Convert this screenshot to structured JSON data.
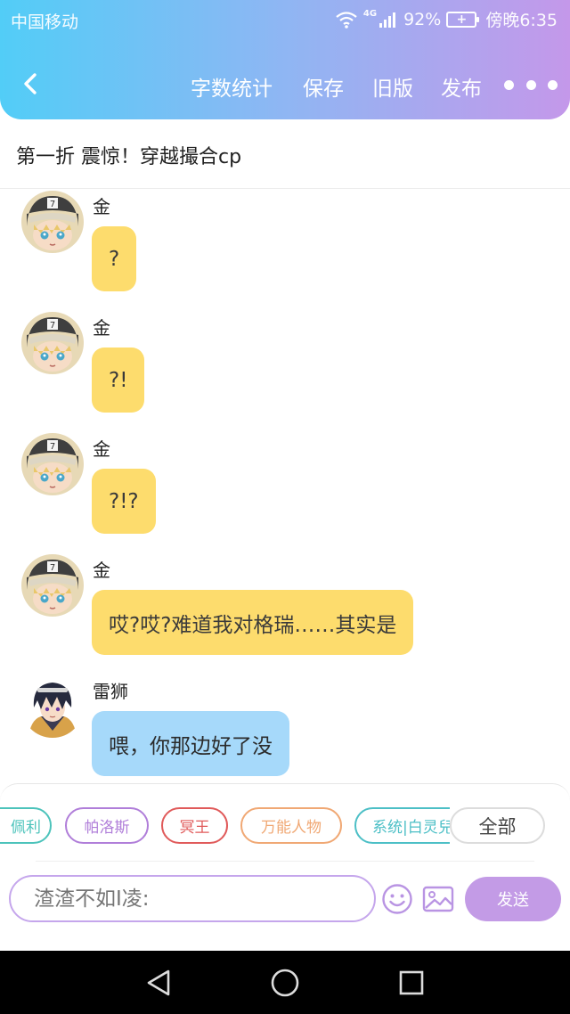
{
  "status_bar": {
    "carrier": "中国移动",
    "network": "4G",
    "battery": "92%",
    "time": "傍晚6:35"
  },
  "toolbar": {
    "word_count": "字数统计",
    "save": "保存",
    "old_version": "旧版",
    "publish": "发布"
  },
  "chapter": {
    "title": "第一折 震惊！穿越撮合cp"
  },
  "messages": [
    {
      "sender": "金",
      "text": "?",
      "style": "yellow"
    },
    {
      "sender": "金",
      "text": "?!",
      "style": "yellow"
    },
    {
      "sender": "金",
      "text": "?!?",
      "style": "yellow"
    },
    {
      "sender": "金",
      "text": "哎?哎?难道我对格瑞……其实是",
      "style": "yellow"
    },
    {
      "sender": "雷狮",
      "text": "喂，你那边好了没",
      "style": "blue"
    }
  ],
  "characters": [
    {
      "name": "佩利",
      "color": "#4cc3bb"
    },
    {
      "name": "帕洛斯",
      "color": "#b07ed9"
    },
    {
      "name": "冥王",
      "color": "#e05a5a"
    },
    {
      "name": "万能人物",
      "color": "#f0a874"
    },
    {
      "name": "系统|白灵兒",
      "color": "#4cbfc6"
    }
  ],
  "all_label": "全部",
  "input": {
    "placeholder": "渣渣不如I凌:"
  },
  "send_label": "发送",
  "colors": {
    "header_start": "#52cdf7",
    "header_end": "#c498ea",
    "bubble_yellow": "#fddc6d",
    "bubble_blue": "#a6d9fa",
    "accent_purple": "#c39be6"
  }
}
